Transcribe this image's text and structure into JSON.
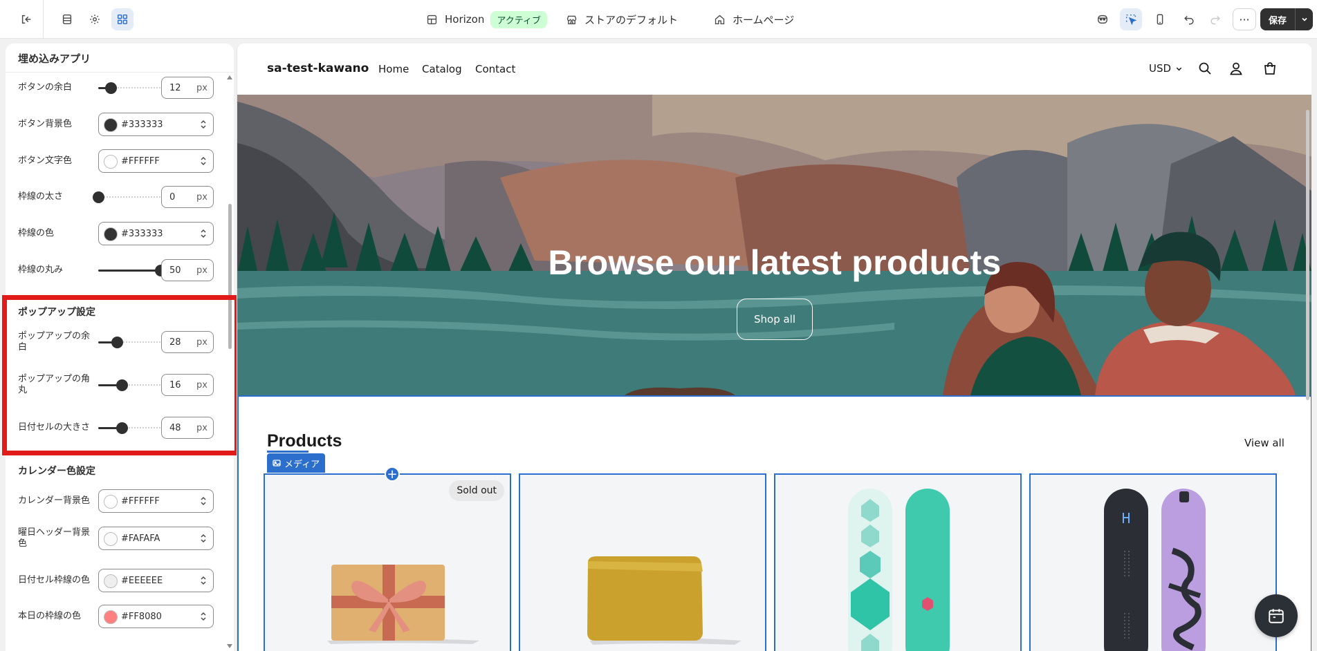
{
  "topbar": {
    "theme_name": "Horizon",
    "theme_status": "アクティブ",
    "store_default": "ストアのデフォルト",
    "homepage": "ホームページ",
    "save_label": "保存",
    "more_label": "···"
  },
  "panel": {
    "header": "埋め込みアプリ",
    "rows_top": [
      {
        "label": "ボタンの余白",
        "type": "slider",
        "value": "12",
        "unit": "px",
        "fraction": 0.2
      },
      {
        "label": "ボタン背景色",
        "type": "color",
        "value": "#333333",
        "swatch": "#333333"
      },
      {
        "label": "ボタン文字色",
        "type": "color",
        "value": "#FFFFFF",
        "swatch": "#FFFFFF"
      },
      {
        "label": "枠線の太さ",
        "type": "slider",
        "value": "0",
        "unit": "px",
        "fraction": 0.0
      },
      {
        "label": "枠線の色",
        "type": "color",
        "value": "#333333",
        "swatch": "#333333"
      },
      {
        "label": "枠線の丸み",
        "type": "slider",
        "value": "50",
        "unit": "px",
        "fraction": 1.0
      }
    ],
    "popup_title": "ポップアップ設定",
    "popup_rows": [
      {
        "label": "ポップアップの余白",
        "type": "slider",
        "value": "28",
        "unit": "px",
        "fraction": 0.3
      },
      {
        "label": "ポップアップの角丸",
        "type": "slider",
        "value": "16",
        "unit": "px",
        "fraction": 0.38
      },
      {
        "label": "日付セルの大きさ",
        "type": "slider",
        "value": "48",
        "unit": "px",
        "fraction": 0.38
      }
    ],
    "calendar_title": "カレンダー色設定",
    "calendar_rows": [
      {
        "label": "カレンダー背景色",
        "type": "color",
        "value": "#FFFFFF",
        "swatch": "#FFFFFF"
      },
      {
        "label": "曜日ヘッダー背景色",
        "type": "color",
        "value": "#FAFAFA",
        "swatch": "#FAFAFA"
      },
      {
        "label": "日付セル枠線の色",
        "type": "color",
        "value": "#EEEEEE",
        "swatch": "#EEEEEE"
      },
      {
        "label": "本日の枠線の色",
        "type": "color",
        "value": "#FF8080",
        "swatch": "#FF8080"
      }
    ]
  },
  "store": {
    "name": "sa-test-kawano",
    "nav": [
      "Home",
      "Catalog",
      "Contact"
    ],
    "currency": "USD",
    "hero_title": "Browse our latest products",
    "hero_button": "Shop all",
    "products_title": "Products",
    "view_all": "View all",
    "media_tag": "メディア",
    "sold_out": "Sold out"
  },
  "colors": {
    "accent": "#2c6ecb",
    "highlight": "#e11a1a",
    "active_badge": "#cdfed4"
  }
}
